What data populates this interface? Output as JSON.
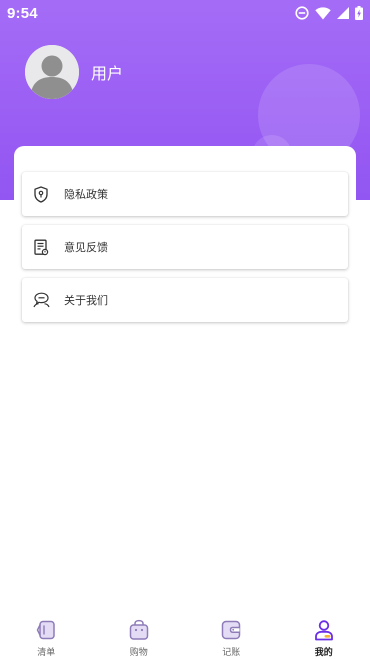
{
  "status_bar": {
    "time": "9:54",
    "icons": [
      "dnd-icon",
      "wifi-icon",
      "signal-icon",
      "battery-charging-icon"
    ]
  },
  "profile": {
    "avatar_icon": "default-avatar-icon",
    "username": "用户"
  },
  "menu": {
    "items": [
      {
        "label": "隐私政策",
        "icon": "shield-icon"
      },
      {
        "label": "意见反馈",
        "icon": "feedback-document-icon"
      },
      {
        "label": "关于我们",
        "icon": "chat-people-icon"
      }
    ]
  },
  "bottom_nav": {
    "items": [
      {
        "label": "清单",
        "icon": "list-icon",
        "active": false
      },
      {
        "label": "购物",
        "icon": "shopping-bag-icon",
        "active": false
      },
      {
        "label": "记账",
        "icon": "wallet-icon",
        "active": false
      },
      {
        "label": "我的",
        "icon": "user-icon",
        "active": true
      }
    ]
  },
  "colors": {
    "header_gradient_top": "#a46cf6",
    "header_gradient_bottom": "#9256f2",
    "nav_inactive": "#8e7bb8",
    "nav_active": "#6a2ee8",
    "nav_active_accent": "#f3b23c"
  }
}
